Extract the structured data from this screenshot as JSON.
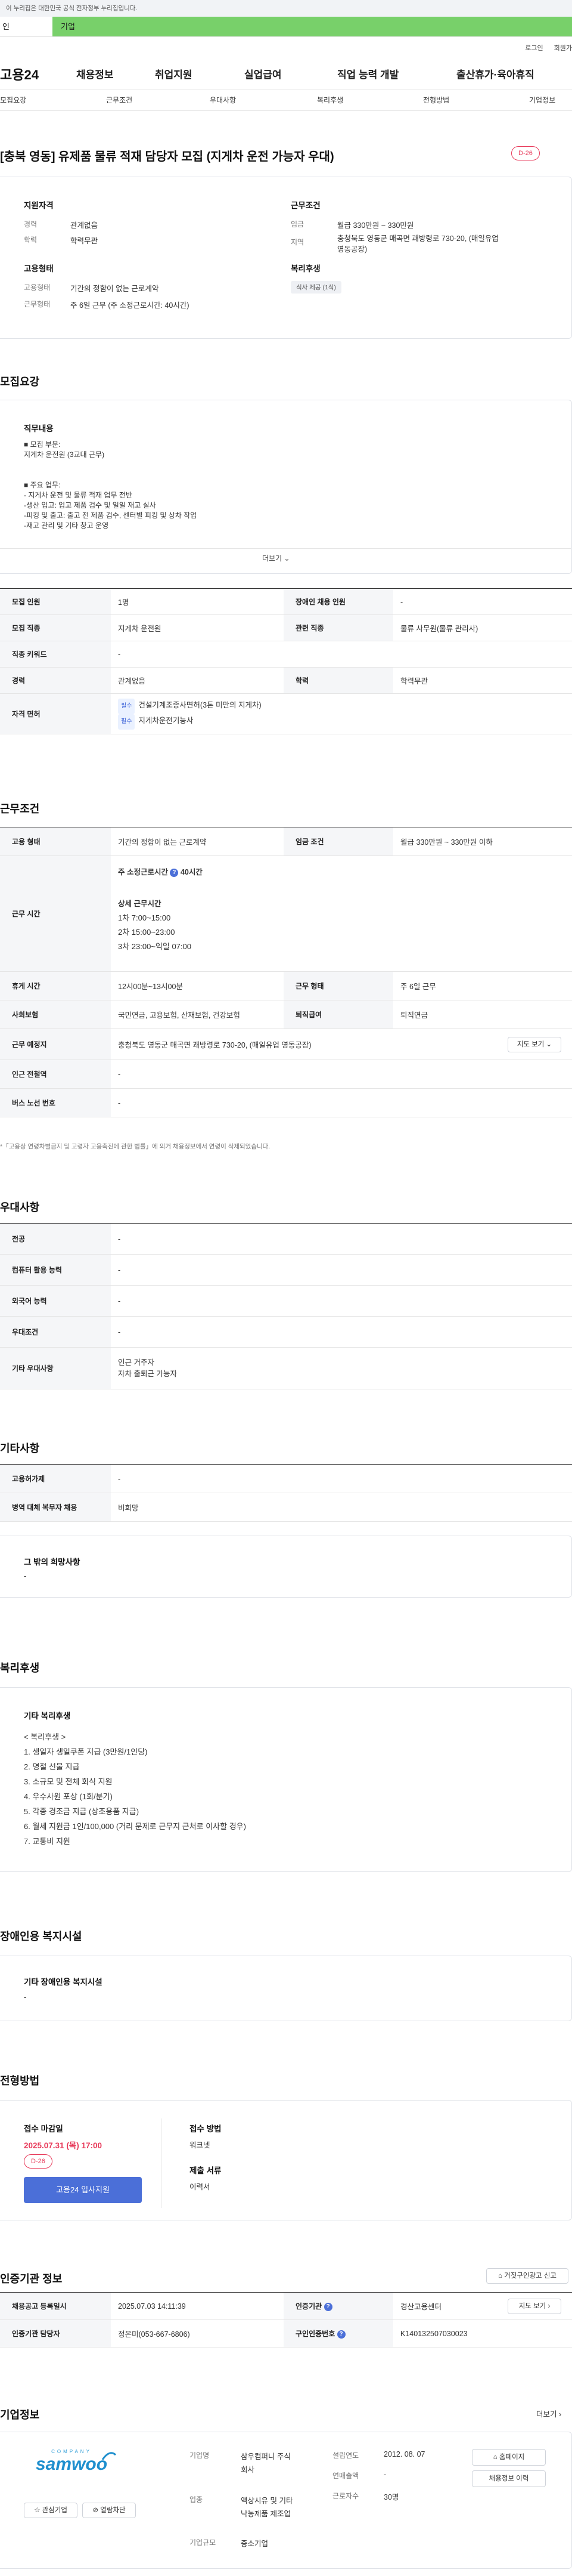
{
  "gov_banner": "이 누리집은 대한민국 공식 전자정부 누리집입니다.",
  "user_tabs": {
    "personal": "인",
    "company": "기업"
  },
  "util": {
    "login": "로그인",
    "join": "회원가"
  },
  "logo": "고용24",
  "gnb": [
    "채용정보",
    "취업지원",
    "실업급여",
    "직업 능력 개발",
    "출산휴가·육아휴직"
  ],
  "subnav": [
    "모집요강",
    "근무조건",
    "우대사항",
    "복리후생",
    "전형방법",
    "기업정보"
  ],
  "job": {
    "title": "[충북 영동] 유제품 물류 적재 담당자 모집 (지게차 운전 가능자 우대)",
    "dday": "D-26"
  },
  "summary": {
    "applicant_head": "지원자격",
    "career_label": "경력",
    "career": "관계없음",
    "edu_label": "학력",
    "edu": "학력무관",
    "cond_head": "근무조건",
    "wage_label": "임금",
    "wage": "월급 330만원 ~ 330만원",
    "loc_label": "지역",
    "loc": "충청북도 영동군 매곡면 괘방령로 730-20, (매일유업\n영동공장)",
    "emp_head": "고용형태",
    "emptype_label": "고용형태",
    "emptype": "기간의 정함이 없는 근로계약",
    "worktype_label": "근무형태",
    "worktype": "주 6일 근무 (주 소정근로시간: 40시간)",
    "welfare_head": "복리후생",
    "welfare_pill": "식사 제공 (1식)"
  },
  "recruit": {
    "section_title": "모집요강",
    "duty_head": "직무내용",
    "duty_text": "■ 모집 부문:\n지게차 운전원 (3교대 근무)\n\n\n■ 주요 업무:\n- 지게차 운전 및 물류 적재 업무 전반\n-생산 입고: 입고 제품 검수 및 일일 재고 실사\n-피킹 및 출고: 출고 전 제품 검수, 센터별 피킹 및 상차 작업\n-재고 관리 및 기타 창고 운영",
    "more": "더보기",
    "rows": {
      "count_l": "모집 인원",
      "count": "1명",
      "dis_l": "장애인 채용 인원",
      "dis": "-",
      "job_l": "모집 직종",
      "job": "지게차 운전원",
      "rel_l": "관련 직종",
      "rel": "물류 사무원(물류 관리사)",
      "kw_l": "직종 키워드",
      "kw": "-",
      "career_l": "경력",
      "career": "관계없음",
      "edu_l": "학력",
      "edu": "학력무관",
      "lic_l": "자격 면허",
      "lic_tag1": "필수",
      "lic1": "건설기계조종사면허(3톤 미만의 지게차)",
      "lic_tag2": "필수",
      "lic2": "지게차운전기능사"
    }
  },
  "cond": {
    "section_title": "근무조건",
    "emp_l": "고용 형태",
    "emp": "기간의 정함이 없는 근로계약",
    "wage_l": "임금 조건",
    "wage": "월급 330만원 ~ 330만원 이하",
    "time_l": "근무 시간",
    "weekly": "주 소정근로시간",
    "weekly_val": "40시간",
    "detail_head": "상세 근무시간",
    "shifts": "1차 7:00~15:00\n2차 15:00~23:00\n3차 23:00~익일 07:00",
    "rest_l": "휴게 시간",
    "rest": "12시00분~13시00분",
    "form_l": "근무 형태",
    "form": "주 6일 근무",
    "ins_l": "사회보험",
    "ins": "국민연금, 고용보험, 산재보험, 건강보험",
    "ret_l": "퇴직급여",
    "ret": "퇴직연금",
    "place_l": "근무 예정지",
    "place": "충청북도 영동군 매곡면 괘방령로 730-20, (매일유업 영동공장)",
    "map_btn": "지도 보기",
    "subway_l": "인근 전철역",
    "subway": "-",
    "bus_l": "버스 노선 번호",
    "bus": "-",
    "note": "*「고용상 연령차별금지 및 고령자 고용촉진에 관한 법률」에 의거 채용정보에서 연령이 삭제되었습니다."
  },
  "pref": {
    "section_title": "우대사항",
    "major_l": "전공",
    "major": "-",
    "pc_l": "컴퓨터 활용 능력",
    "pc": "-",
    "lang_l": "외국어 능력",
    "lang": "-",
    "cond_l": "우대조건",
    "cond": "-",
    "etc_l": "기타 우대사항",
    "etc": "인근 거주자\n자차 출퇴근 가능자"
  },
  "other": {
    "section_title": "기타사항",
    "hire_l": "고용허가제",
    "hire": "-",
    "mil_l": "병역 대체 복무자 채용",
    "mil": "비희망",
    "wish_head": "그 밖의 희망사항",
    "wish": "-"
  },
  "welfare": {
    "section_title": "복리후생",
    "head": "기타 복리후생",
    "text": "< 복리후생 >\n1. 생일자 생일쿠폰 지급 (3만원/1인당)\n2. 명절 선물 지급\n3. 소규모 및 전체 회식 지원\n4. 우수사원 포상 (1회/분기)\n5. 각종 경조금 지급 (상조용품 지급)\n6. 월세 지원금 1인/100,000 (거리 문제로 근무지 근처로 이사할 경우)\n7. 교통비 지원"
  },
  "disab": {
    "section_title": "장애인용 복지시설",
    "head": "기타 장애인용 복지시설",
    "text": "-"
  },
  "selection": {
    "section_title": "전형방법",
    "deadline_l": "접수 마감일",
    "deadline": "2025.07.31 (목) 17:00",
    "dday": "D-26",
    "apply_btn": "고용24 입사지원",
    "method_l": "접수 방법",
    "method": "워크넷",
    "docs_l": "제출 서류",
    "docs": "이력서"
  },
  "cert": {
    "section_title": "인증기관 정보",
    "report_btn": "거짓구인광고 신고",
    "reg_l": "채용공고 등록일시",
    "reg": "2025.07.03 14:11:39",
    "org_l": "인증기관",
    "org": "경산고용센터",
    "map_btn": "지도 보기",
    "mgr_l": "인증기관 담당자",
    "mgr": "정은미(053-667-6806)",
    "num_l": "구인인증번호",
    "num": "K140132507030023"
  },
  "company": {
    "section_title": "기업정보",
    "more": "더보기",
    "logo_small": "COMPANY",
    "logo_big": "samwoo",
    "fav_btn": "관심기업",
    "block_btn": "열람차단",
    "name_l": "기업명",
    "name": "삼우컴퍼니 주식\n회사",
    "ind_l": "업종",
    "ind": "액상시유 및 기타\n낙농제품 제조업",
    "size_l": "기업규모",
    "size": "중소기업",
    "est_l": "설립연도",
    "est": "2012. 08. 07",
    "sales_l": "연매출액",
    "sales": "-",
    "emp_l": "근로자수",
    "emp": "30명",
    "home_btn": "홈페이지",
    "hist_btn": "채용정보 이력"
  },
  "colors": {
    "accent": "#4b6fd8",
    "badge": "#e83a5a",
    "tab_green": "#78d06a"
  }
}
